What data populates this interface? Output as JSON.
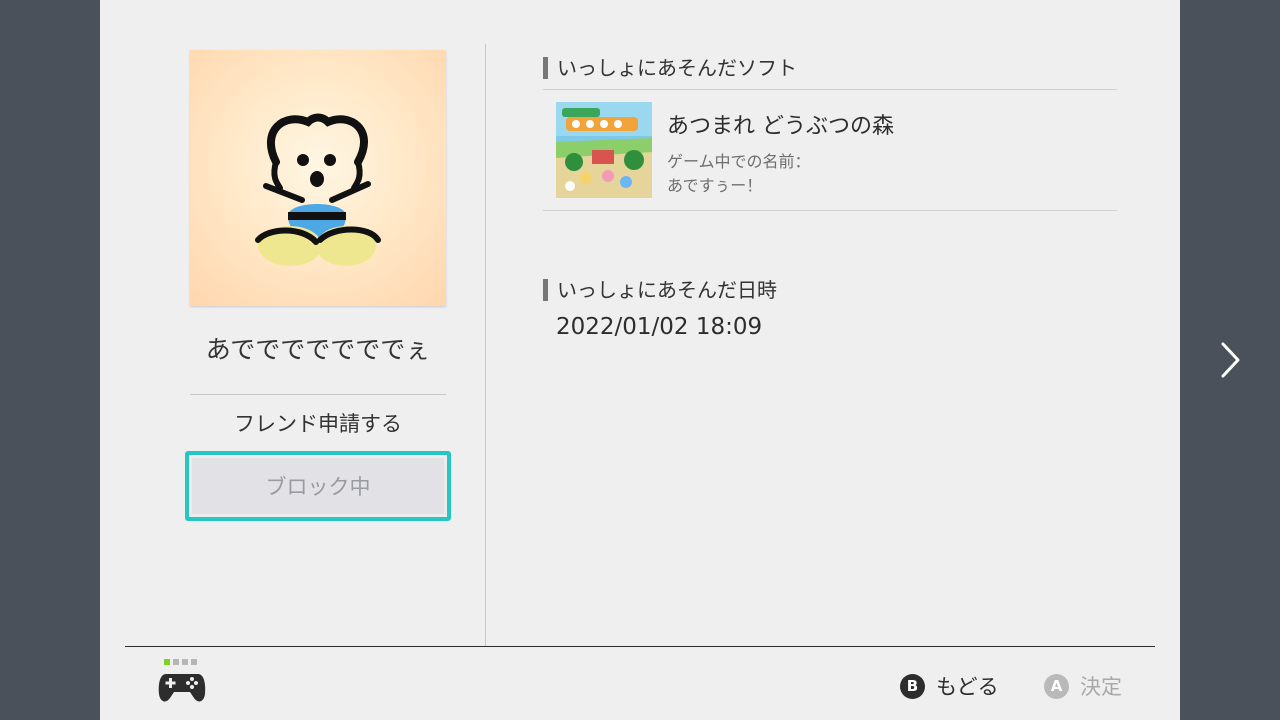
{
  "profile": {
    "username": "あでででででででぇ",
    "friend_request_label": "フレンド申請する",
    "block_label": "ブロック中"
  },
  "played_software": {
    "title": "いっしょにあそんだソフト",
    "game": {
      "name": "あつまれ どうぶつの森",
      "in_game_name_label": "ゲーム中での名前：",
      "in_game_name": "あですぅー！"
    }
  },
  "played_date": {
    "title": "いっしょにあそんだ日時",
    "value": "2022/01/02 18:09"
  },
  "footer": {
    "back_key": "B",
    "back_label": "もどる",
    "ok_key": "A",
    "ok_label": "決定"
  },
  "icons": {
    "controller": "controller-icon",
    "next": "chevron-right-icon"
  },
  "colors": {
    "focus_border": "#26c6c3",
    "player_indicator": "#7ed321",
    "background": "#4b515a",
    "panel": "#efefef"
  }
}
